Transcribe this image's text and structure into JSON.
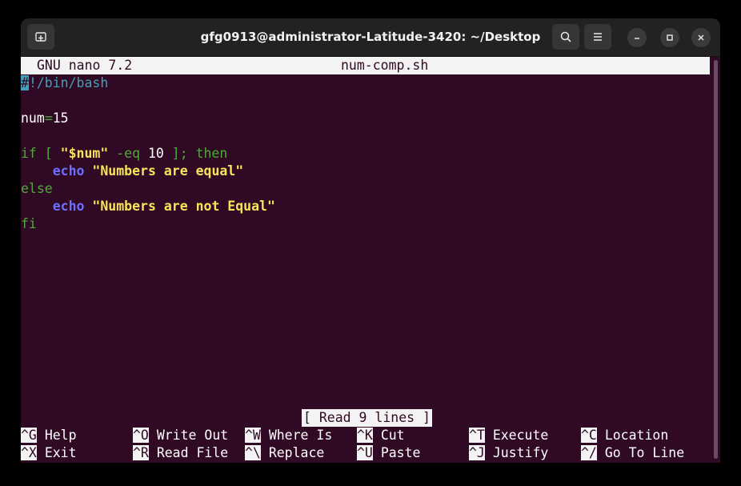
{
  "window": {
    "title": "gfg0913@administrator-Latitude-3420: ~/Desktop",
    "icons": {
      "new_tab": "new-tab-icon",
      "search": "search-icon",
      "menu": "hamburger-menu-icon",
      "minimize": "minimize-icon",
      "maximize": "maximize-icon",
      "close": "close-icon"
    }
  },
  "nano": {
    "version": "GNU nano 7.2",
    "filename": "num-comp.sh",
    "status": "[ Read 9 lines ]"
  },
  "code": {
    "line1_cursor": "#",
    "line1_rest": "!/bin/bash",
    "line3_var": "num",
    "line3_eq": "=",
    "line3_val": "15",
    "line5_if": "if [ ",
    "line5_var": "\"$num\"",
    "line5_op": " -eq ",
    "line5_num": "10",
    "line5_end": " ]; then",
    "line6_indent": "    ",
    "line6_echo": "echo",
    "line6_str": " \"Numbers are equal\"",
    "line7_else": "else",
    "line8_indent": "    ",
    "line8_echo": "echo",
    "line8_str": " \"Numbers are not Equal\"",
    "line9_fi": "fi"
  },
  "shortcuts": {
    "row1": [
      {
        "key": "^G",
        "label": "Help"
      },
      {
        "key": "^O",
        "label": "Write Out"
      },
      {
        "key": "^W",
        "label": "Where Is"
      },
      {
        "key": "^K",
        "label": "Cut"
      },
      {
        "key": "^T",
        "label": "Execute"
      },
      {
        "key": "^C",
        "label": "Location"
      }
    ],
    "row2": [
      {
        "key": "^X",
        "label": "Exit"
      },
      {
        "key": "^R",
        "label": "Read File"
      },
      {
        "key": "^\\",
        "label": "Replace"
      },
      {
        "key": "^U",
        "label": "Paste"
      },
      {
        "key": "^J",
        "label": "Justify"
      },
      {
        "key": "^/",
        "label": "Go To Line"
      }
    ]
  },
  "colors": {
    "terminal_bg": "#300a24",
    "titlebar_bg": "#222222",
    "comment": "#42a1b8",
    "keyword": "#4fa83a",
    "echo": "#6e6efc",
    "string": "#f8e35a"
  }
}
